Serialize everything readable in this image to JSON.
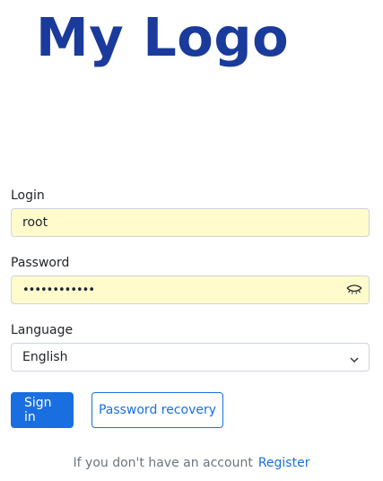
{
  "logo": {
    "text": "My Logo"
  },
  "form": {
    "login": {
      "label": "Login",
      "value": "root"
    },
    "password": {
      "label": "Password",
      "value": "••••••••••••"
    },
    "language": {
      "label": "Language",
      "value": "English"
    }
  },
  "buttons": {
    "sign_in": "Sign in",
    "recovery": "Password recovery"
  },
  "footer": {
    "prompt": "If you don't have an account",
    "register_link": "Register"
  },
  "icons": {
    "password_toggle": "closed-eye-icon",
    "select_arrow": "chevron-down-icon"
  },
  "colors": {
    "brand": "#1a3b9c",
    "accent": "#1a6fe0",
    "autofill": "#fffbcc"
  }
}
